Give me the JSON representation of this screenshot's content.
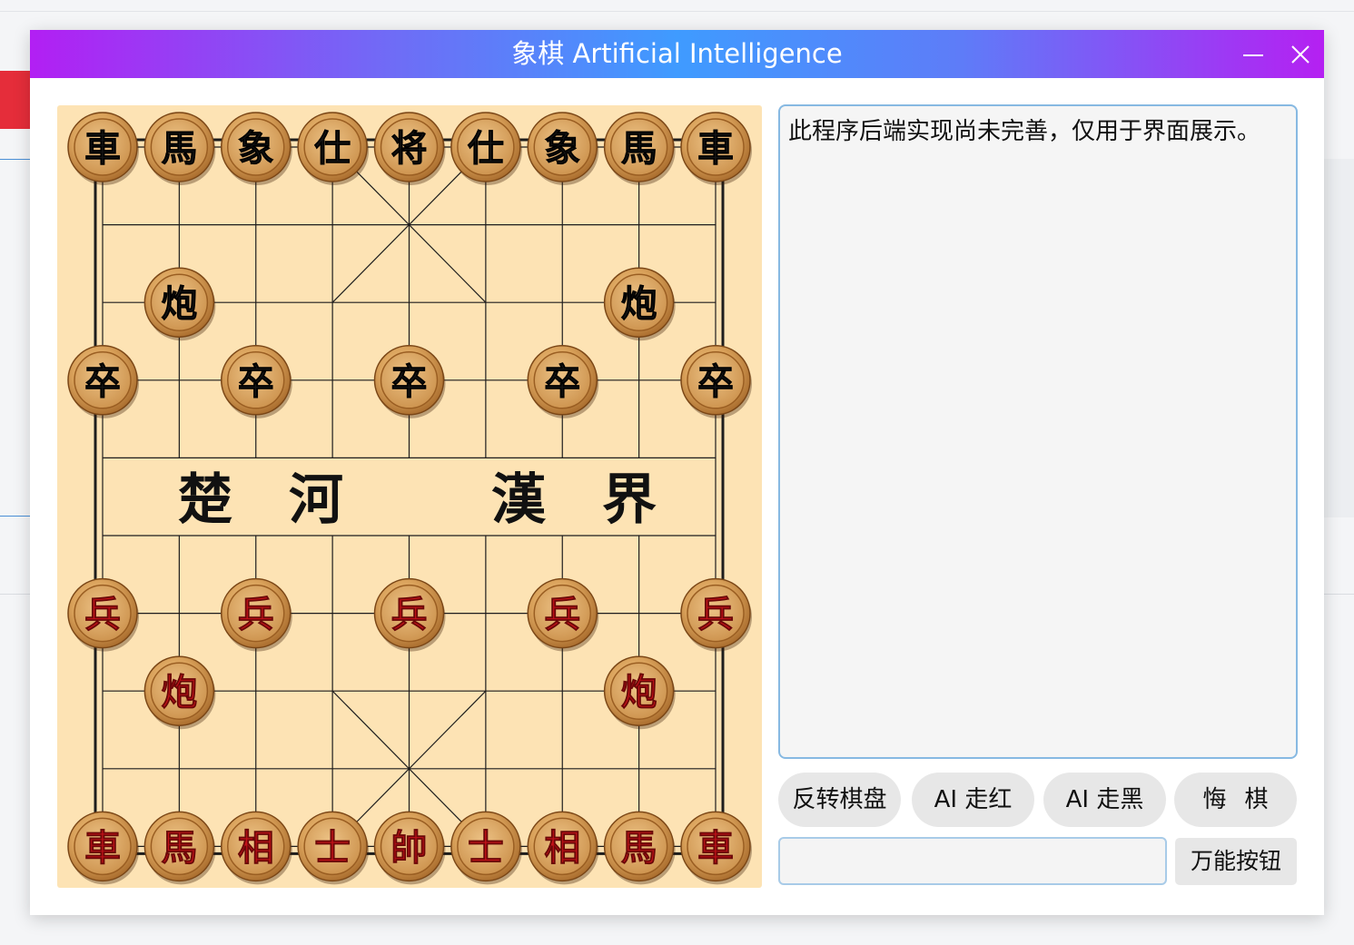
{
  "window": {
    "title": "象棋 Artificial Intelligence",
    "minimize_icon": "minimize-icon",
    "close_icon": "close-icon",
    "title_gradient": [
      "#b21ff3",
      "#3f9bff",
      "#b520f2"
    ]
  },
  "board": {
    "river_left": [
      "楚",
      "河"
    ],
    "river_right": [
      "漢",
      "界"
    ],
    "background_color": "#fde3b4",
    "pieces": [
      {
        "side": "black",
        "label": "車",
        "file": 0,
        "rank": 0
      },
      {
        "side": "black",
        "label": "馬",
        "file": 1,
        "rank": 0
      },
      {
        "side": "black",
        "label": "象",
        "file": 2,
        "rank": 0
      },
      {
        "side": "black",
        "label": "仕",
        "file": 3,
        "rank": 0
      },
      {
        "side": "black",
        "label": "将",
        "file": 4,
        "rank": 0
      },
      {
        "side": "black",
        "label": "仕",
        "file": 5,
        "rank": 0
      },
      {
        "side": "black",
        "label": "象",
        "file": 6,
        "rank": 0
      },
      {
        "side": "black",
        "label": "馬",
        "file": 7,
        "rank": 0
      },
      {
        "side": "black",
        "label": "車",
        "file": 8,
        "rank": 0
      },
      {
        "side": "black",
        "label": "炮",
        "file": 1,
        "rank": 2
      },
      {
        "side": "black",
        "label": "炮",
        "file": 7,
        "rank": 2
      },
      {
        "side": "black",
        "label": "卒",
        "file": 0,
        "rank": 3
      },
      {
        "side": "black",
        "label": "卒",
        "file": 2,
        "rank": 3
      },
      {
        "side": "black",
        "label": "卒",
        "file": 4,
        "rank": 3
      },
      {
        "side": "black",
        "label": "卒",
        "file": 6,
        "rank": 3
      },
      {
        "side": "black",
        "label": "卒",
        "file": 8,
        "rank": 3
      },
      {
        "side": "red",
        "label": "兵",
        "file": 0,
        "rank": 6
      },
      {
        "side": "red",
        "label": "兵",
        "file": 2,
        "rank": 6
      },
      {
        "side": "red",
        "label": "兵",
        "file": 4,
        "rank": 6
      },
      {
        "side": "red",
        "label": "兵",
        "file": 6,
        "rank": 6
      },
      {
        "side": "red",
        "label": "兵",
        "file": 8,
        "rank": 6
      },
      {
        "side": "red",
        "label": "炮",
        "file": 1,
        "rank": 7
      },
      {
        "side": "red",
        "label": "炮",
        "file": 7,
        "rank": 7
      },
      {
        "side": "red",
        "label": "車",
        "file": 0,
        "rank": 9
      },
      {
        "side": "red",
        "label": "馬",
        "file": 1,
        "rank": 9
      },
      {
        "side": "red",
        "label": "相",
        "file": 2,
        "rank": 9
      },
      {
        "side": "red",
        "label": "士",
        "file": 3,
        "rank": 9
      },
      {
        "side": "red",
        "label": "帥",
        "file": 4,
        "rank": 9
      },
      {
        "side": "red",
        "label": "士",
        "file": 5,
        "rank": 9
      },
      {
        "side": "red",
        "label": "相",
        "file": 6,
        "rank": 9
      },
      {
        "side": "red",
        "label": "馬",
        "file": 7,
        "rank": 9
      },
      {
        "side": "red",
        "label": "車",
        "file": 8,
        "rank": 9
      }
    ],
    "colors": {
      "red_text": "#c4121a",
      "black_text": "#161616",
      "piece_wood": "#d9a15a"
    }
  },
  "log": {
    "text": "此程序后端实现尚未完善，仅用于界面展示。"
  },
  "controls": {
    "flip_board": "反转棋盘",
    "ai_move_red": "AI 走红",
    "ai_move_black": "AI 走黑",
    "undo": "悔棋",
    "command_input_value": "",
    "command_input_placeholder": "",
    "magic_button": "万能按钮"
  }
}
